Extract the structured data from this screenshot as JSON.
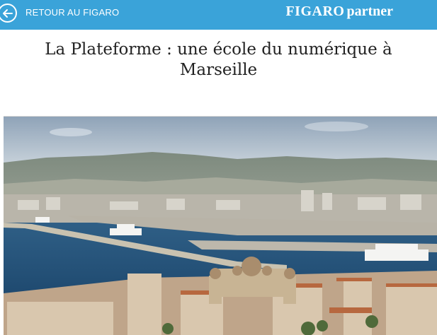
{
  "topbar": {
    "back_label": "RETOUR AU FIGARO",
    "brand_bold": "FIGARO",
    "brand_suffix": "partner",
    "color": "#3aa3d9"
  },
  "article": {
    "title": "La Plateforme : une école du numérique à Marseille"
  },
  "hero": {
    "image_subject": "aerial view of Marseille port"
  }
}
